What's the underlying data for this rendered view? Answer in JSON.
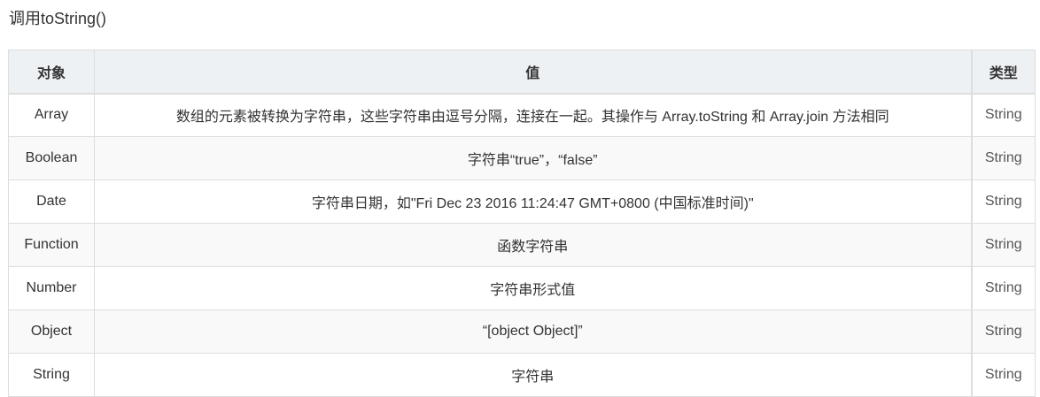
{
  "heading": "调用toString()",
  "table": {
    "headers": [
      "对象",
      "值",
      "类型"
    ],
    "rows": [
      {
        "object": "Array",
        "value": "数组的元素被转换为字符串，这些字符串由逗号分隔，连接在一起。其操作与 Array.toString 和 Array.join 方法相同",
        "type": "String"
      },
      {
        "object": "Boolean",
        "value": "字符串“true”，“false”",
        "type": "String"
      },
      {
        "object": "Date",
        "value": "字符串日期，如\"Fri Dec 23 2016 11:24:47 GMT+0800 (中国标准时间)\"",
        "type": "String"
      },
      {
        "object": "Function",
        "value": "函数字符串",
        "type": "String"
      },
      {
        "object": "Number",
        "value": "字符串形式值",
        "type": "String"
      },
      {
        "object": "Object",
        "value": "“[object Object]”",
        "type": "String"
      },
      {
        "object": "String",
        "value": "字符串",
        "type": "String"
      }
    ]
  }
}
